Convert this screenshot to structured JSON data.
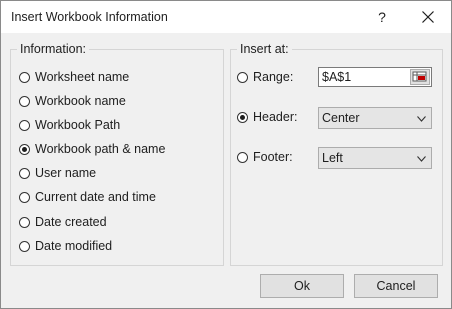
{
  "window": {
    "title": "Insert Workbook Information",
    "help_label": "?"
  },
  "information": {
    "legend": "Information:",
    "options": [
      {
        "label": "Worksheet name",
        "checked": false
      },
      {
        "label": "Workbook name",
        "checked": false
      },
      {
        "label": "Workbook Path",
        "checked": false
      },
      {
        "label": "Workbook path & name",
        "checked": true
      },
      {
        "label": "User name",
        "checked": false
      },
      {
        "label": "Current date and time",
        "checked": false
      },
      {
        "label": "Date created",
        "checked": false
      },
      {
        "label": "Date modified",
        "checked": false
      }
    ]
  },
  "insert_at": {
    "legend": "Insert at:",
    "range": {
      "label": "Range:",
      "value": "$A$1",
      "checked": false
    },
    "header": {
      "label": "Header:",
      "value": "Center",
      "checked": true
    },
    "footer": {
      "label": "Footer:",
      "value": "Left",
      "checked": false
    }
  },
  "buttons": {
    "ok": "Ok",
    "cancel": "Cancel"
  }
}
